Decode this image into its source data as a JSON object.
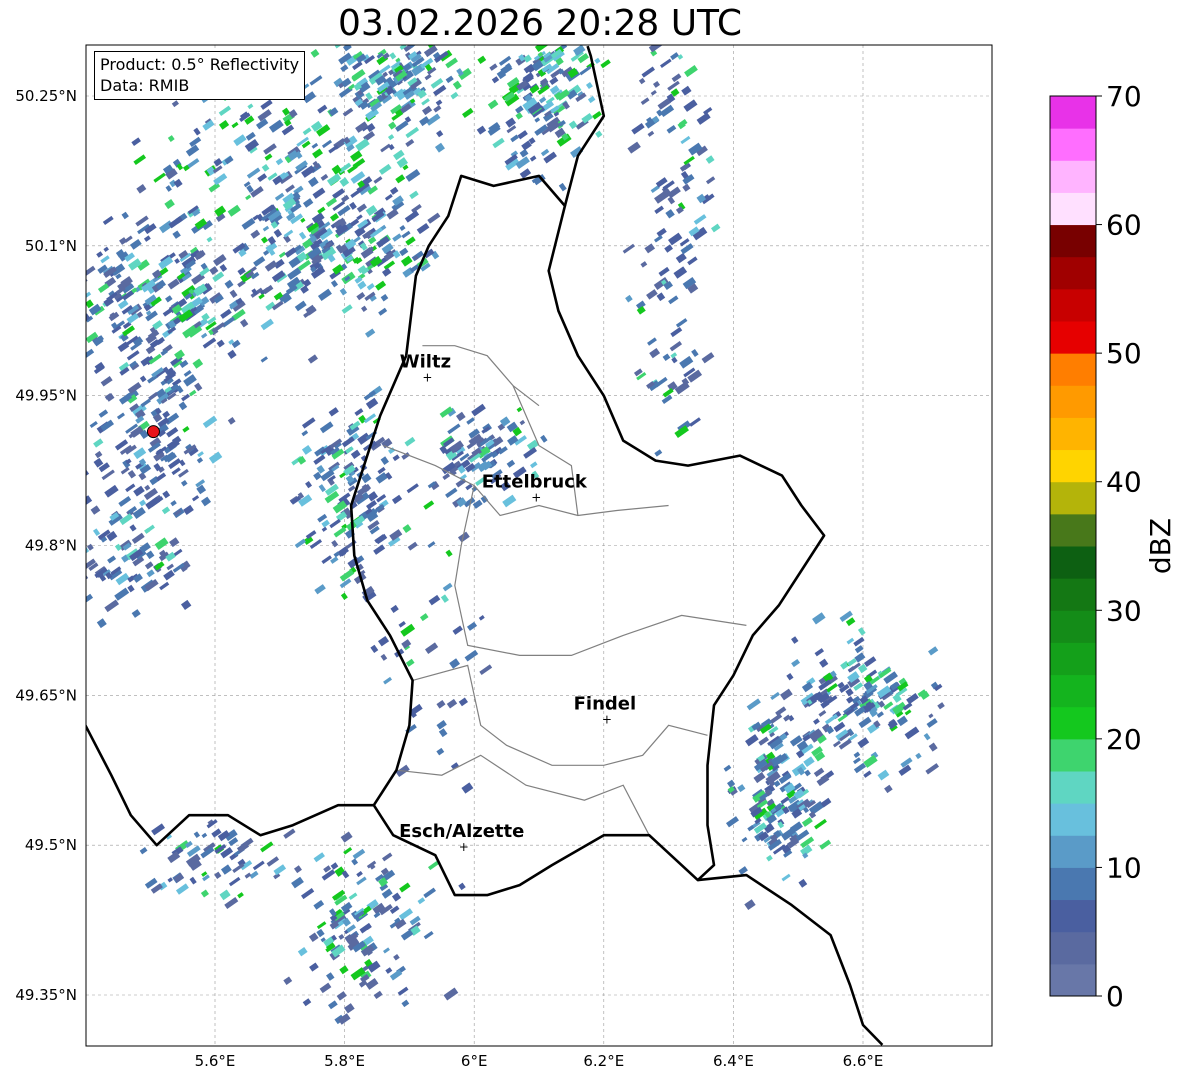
{
  "title": "03.02.2026 20:28 UTC",
  "info": {
    "product": "Product: 0.5° Reflectivity",
    "source": "Data: RMIB"
  },
  "map": {
    "lon_range": [
      5.4,
      6.8
    ],
    "lat_range": [
      49.3,
      50.3
    ],
    "lon_ticks": [
      {
        "value": 5.6,
        "label": "5.6°E"
      },
      {
        "value": 5.8,
        "label": "5.8°E"
      },
      {
        "value": 6.0,
        "label": "6°E"
      },
      {
        "value": 6.2,
        "label": "6.2°E"
      },
      {
        "value": 6.4,
        "label": "6.4°E"
      },
      {
        "value": 6.6,
        "label": "6.6°E"
      }
    ],
    "lat_ticks": [
      {
        "value": 49.35,
        "label": "49.35°N"
      },
      {
        "value": 49.5,
        "label": "49.5°N"
      },
      {
        "value": 49.65,
        "label": "49.65°N"
      },
      {
        "value": 49.8,
        "label": "49.8°N"
      },
      {
        "value": 49.95,
        "label": "49.95°N"
      },
      {
        "value": 50.1,
        "label": "50.1°N"
      },
      {
        "value": 50.25,
        "label": "50.25°N"
      }
    ],
    "grid": true,
    "cities": [
      {
        "name": "Wiltz",
        "lon": 5.934,
        "lat": 49.969
      },
      {
        "name": "Ettelbruck",
        "lon": 6.102,
        "lat": 49.849
      },
      {
        "name": "Findel",
        "lon": 6.211,
        "lat": 49.627
      },
      {
        "name": "Esch/Alzette",
        "lon": 5.99,
        "lat": 49.499
      }
    ],
    "radar_site": {
      "lon": 5.505,
      "lat": 49.914,
      "color": "#e8141a"
    },
    "lux_border": [
      [
        5.895,
        49.99
      ],
      [
        5.855,
        49.93
      ],
      [
        5.83,
        49.88
      ],
      [
        5.81,
        49.84
      ],
      [
        5.815,
        49.79
      ],
      [
        5.835,
        49.745
      ],
      [
        5.87,
        49.71
      ],
      [
        5.905,
        49.665
      ],
      [
        5.9,
        49.62
      ],
      [
        5.88,
        49.575
      ],
      [
        5.845,
        49.54
      ],
      [
        5.875,
        49.51
      ],
      [
        5.94,
        49.49
      ],
      [
        5.97,
        49.45
      ],
      [
        6.02,
        49.45
      ],
      [
        6.07,
        49.46
      ],
      [
        6.12,
        49.48
      ],
      [
        6.2,
        49.51
      ],
      [
        6.27,
        49.51
      ],
      [
        6.345,
        49.465
      ],
      [
        6.37,
        49.48
      ],
      [
        6.36,
        49.52
      ],
      [
        6.36,
        49.58
      ],
      [
        6.37,
        49.64
      ],
      [
        6.4,
        49.67
      ],
      [
        6.43,
        49.71
      ],
      [
        6.47,
        49.74
      ],
      [
        6.51,
        49.78
      ],
      [
        6.54,
        49.81
      ],
      [
        6.505,
        49.84
      ],
      [
        6.475,
        49.87
      ],
      [
        6.41,
        49.89
      ],
      [
        6.33,
        49.88
      ],
      [
        6.28,
        49.885
      ],
      [
        6.23,
        49.905
      ],
      [
        6.2,
        49.95
      ],
      [
        6.16,
        49.99
      ],
      [
        6.13,
        50.035
      ],
      [
        6.115,
        50.075
      ],
      [
        6.14,
        50.14
      ],
      [
        6.1,
        50.17
      ],
      [
        6.03,
        50.16
      ],
      [
        5.98,
        50.17
      ],
      [
        5.96,
        50.13
      ],
      [
        5.93,
        50.1
      ],
      [
        5.91,
        50.07
      ],
      [
        5.895,
        49.99
      ]
    ],
    "fr_be_border": [
      [
        5.4,
        49.62
      ],
      [
        5.44,
        49.57
      ],
      [
        5.47,
        49.53
      ],
      [
        5.51,
        49.5
      ],
      [
        5.56,
        49.53
      ],
      [
        5.62,
        49.53
      ],
      [
        5.67,
        49.51
      ],
      [
        5.72,
        49.52
      ],
      [
        5.79,
        49.54
      ],
      [
        5.845,
        49.54
      ]
    ],
    "de_border": [
      [
        6.345,
        49.465
      ],
      [
        6.42,
        49.47
      ],
      [
        6.49,
        49.44
      ],
      [
        6.55,
        49.41
      ],
      [
        6.58,
        49.36
      ],
      [
        6.6,
        49.32
      ],
      [
        6.63,
        49.3
      ]
    ],
    "de_be_border": [
      [
        6.14,
        50.14
      ],
      [
        6.16,
        50.19
      ],
      [
        6.2,
        50.23
      ],
      [
        6.18,
        50.29
      ],
      [
        6.175,
        50.3
      ]
    ],
    "canton_lines": [
      [
        [
          5.92,
          50.0
        ],
        [
          5.97,
          50.0
        ],
        [
          6.02,
          49.99
        ],
        [
          6.06,
          49.96
        ],
        [
          6.1,
          49.94
        ]
      ],
      [
        [
          5.86,
          49.9
        ],
        [
          5.94,
          49.88
        ],
        [
          6.0,
          49.86
        ],
        [
          6.04,
          49.83
        ],
        [
          6.1,
          49.84
        ],
        [
          6.16,
          49.83
        ],
        [
          6.22,
          49.835
        ],
        [
          6.3,
          49.84
        ]
      ],
      [
        [
          6.0,
          49.86
        ],
        [
          5.98,
          49.8
        ],
        [
          5.97,
          49.76
        ],
        [
          5.99,
          49.7
        ],
        [
          6.07,
          49.69
        ],
        [
          6.15,
          49.69
        ],
        [
          6.23,
          49.71
        ],
        [
          6.32,
          49.73
        ],
        [
          6.42,
          49.72
        ]
      ],
      [
        [
          5.905,
          49.665
        ],
        [
          5.99,
          49.68
        ],
        [
          6.01,
          49.62
        ],
        [
          6.05,
          49.6
        ],
        [
          6.12,
          49.58
        ],
        [
          6.2,
          49.58
        ],
        [
          6.26,
          49.59
        ],
        [
          6.3,
          49.62
        ],
        [
          6.36,
          49.61
        ]
      ],
      [
        [
          6.06,
          49.96
        ],
        [
          6.1,
          49.9
        ],
        [
          6.15,
          49.88
        ],
        [
          6.16,
          49.83
        ]
      ],
      [
        [
          5.88,
          49.575
        ],
        [
          5.95,
          49.57
        ],
        [
          6.01,
          49.59
        ],
        [
          6.08,
          49.56
        ],
        [
          6.17,
          49.545
        ],
        [
          6.23,
          49.56
        ],
        [
          6.27,
          49.51
        ]
      ]
    ]
  },
  "colorbar": {
    "label": "dBZ",
    "min": 0,
    "max": 70,
    "ticks": [
      {
        "value": 0,
        "label": "0"
      },
      {
        "value": 10,
        "label": "10"
      },
      {
        "value": 20,
        "label": "20"
      },
      {
        "value": 30,
        "label": "30"
      },
      {
        "value": 40,
        "label": "40"
      },
      {
        "value": 50,
        "label": "50"
      },
      {
        "value": 60,
        "label": "60"
      },
      {
        "value": 70,
        "label": "70"
      }
    ],
    "colors": [
      "#6877a8",
      "#5a6aa0",
      "#4a5fa0",
      "#4a78b0",
      "#5a9bc8",
      "#68c0dd",
      "#5fd6c2",
      "#3ed46e",
      "#14c81e",
      "#14b41e",
      "#14a01a",
      "#148c18",
      "#147814",
      "#0d6012",
      "#48781a",
      "#b4b40a",
      "#ffd400",
      "#ffb400",
      "#ff9a00",
      "#ff7e00",
      "#e60000",
      "#c80000",
      "#a00000",
      "#780000",
      "#ffe0ff",
      "#ffb4ff",
      "#ff6eff",
      "#e832e8"
    ]
  }
}
